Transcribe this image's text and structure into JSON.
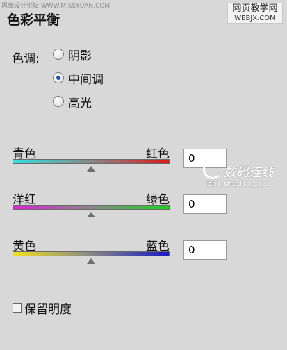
{
  "watermarks": {
    "top_left": "思缘设计论坛 WWW.MISSYUAN.COM",
    "top_right_line1": "网页教学网",
    "top_right_line2": "WEBJX.COM",
    "side_brand": "数码连线",
    "side_url": "bbs.shudoo.com"
  },
  "panel": {
    "title": "色彩平衡"
  },
  "tone": {
    "label": "色调:",
    "options": [
      {
        "label": "阴影",
        "checked": false
      },
      {
        "label": "中间调",
        "checked": true
      },
      {
        "label": "高光",
        "checked": false
      }
    ]
  },
  "sliders": [
    {
      "left_label": "青色",
      "right_label": "红色",
      "value": "0",
      "position": 0.5,
      "colors": [
        "#33e0e0",
        "#888888",
        "#e01818"
      ]
    },
    {
      "left_label": "洋红",
      "right_label": "绿色",
      "value": "0",
      "position": 0.5,
      "colors": [
        "#e020d8",
        "#888888",
        "#18d818"
      ]
    },
    {
      "left_label": "黄色",
      "right_label": "蓝色",
      "value": "0",
      "position": 0.5,
      "colors": [
        "#f0e020",
        "#888888",
        "#1818c8"
      ]
    }
  ],
  "preserve_luminosity": {
    "label": "保留明度",
    "checked": false
  }
}
